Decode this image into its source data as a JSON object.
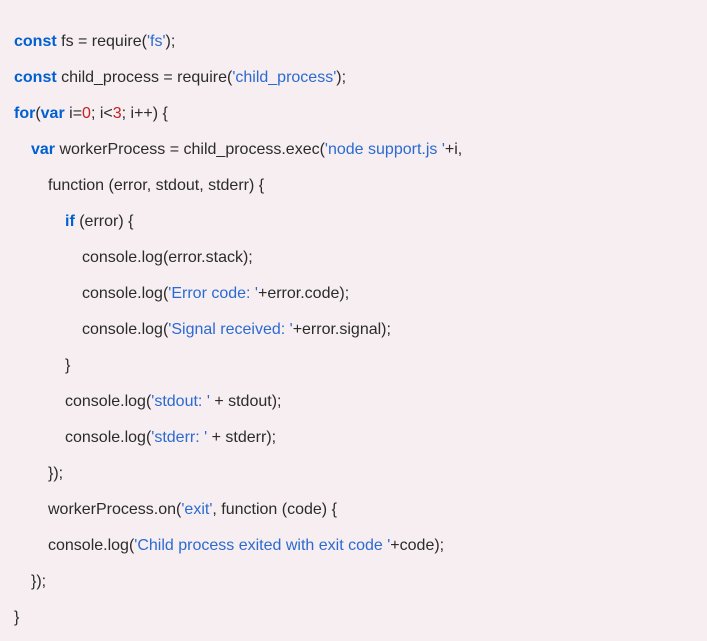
{
  "code": {
    "l1": {
      "kw": "const",
      "t1": " fs = require(",
      "s": "'fs'",
      "t2": ");"
    },
    "l2": {
      "kw": "const",
      "t1": " child_process = require(",
      "s": "'child_process'",
      "t2": ");"
    },
    "l3": {
      "kw1": "for",
      "t1": "(",
      "kw2": "var",
      "t2": " i=",
      "n1": "0",
      "t3": "; i<",
      "n2": "3",
      "t4": "; i++) {"
    },
    "l4": {
      "kw": "var",
      "t1": " workerProcess = child_process.exec(",
      "s": "'node support.js '",
      "t2": "+i,"
    },
    "l5": {
      "t": "function (error, stdout, stderr) {"
    },
    "l6": {
      "kw": "if",
      "t": " (error) {"
    },
    "l7": {
      "t": "console.log(error.stack);"
    },
    "l8": {
      "t1": "console.log(",
      "s": "'Error code: '",
      "t2": "+error.code);"
    },
    "l9": {
      "t1": "console.log(",
      "s": "'Signal received: '",
      "t2": "+error.signal);"
    },
    "l10": {
      "t": "}"
    },
    "l11": {
      "t1": "console.log(",
      "s": "'stdout: '",
      "t2": " + stdout);"
    },
    "l12": {
      "t1": "console.log(",
      "s": "'stderr: '",
      "t2": " + stderr);"
    },
    "l13": {
      "t": "});"
    },
    "l14": {
      "t1": "workerProcess.on(",
      "s": "'exit'",
      "t2": ", function (code) {"
    },
    "l15": {
      "t1": "console.log(",
      "s": "'Child process exited with exit code '",
      "t2": "+code);"
    },
    "l16": {
      "t": "});"
    },
    "l17": {
      "t": "}"
    }
  }
}
